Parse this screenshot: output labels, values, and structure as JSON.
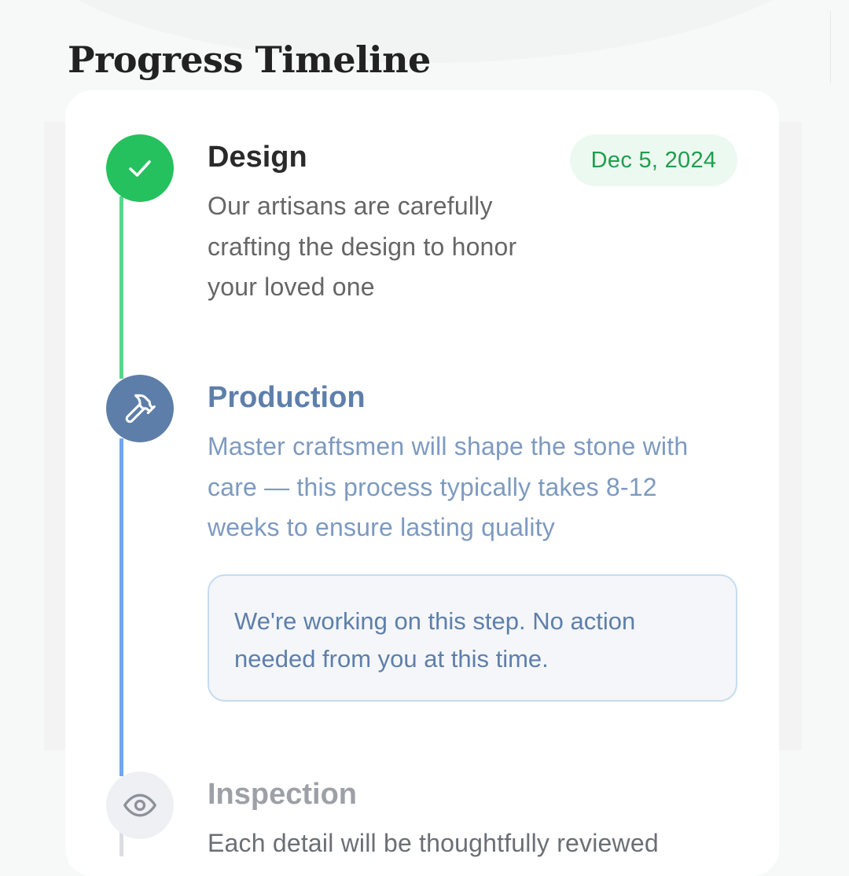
{
  "page": {
    "title": "Progress Timeline"
  },
  "steps": [
    {
      "title": "Design",
      "description": "Our artisans are carefully crafting the design to honor your loved one",
      "date": "Dec 5, 2024",
      "status": "completed",
      "icon": "checkmark-icon"
    },
    {
      "title": "Production",
      "description": "Master craftsmen will shape the stone with care — this process typically takes 8-12 weeks to ensure lasting quality",
      "status": "in-progress",
      "icon": "hammer-icon",
      "note": "We're working on this step. No action needed from you at this time."
    },
    {
      "title": "Inspection",
      "description": "Each detail will be thoughtfully reviewed",
      "status": "pending",
      "icon": "eye-icon"
    }
  ],
  "colors": {
    "completed": "#24c15e",
    "in_progress": "#5d7ea8",
    "progress_rail": "#6ea8f0",
    "pending": "#eef0f3",
    "date_badge_text": "#1f9e4e"
  }
}
